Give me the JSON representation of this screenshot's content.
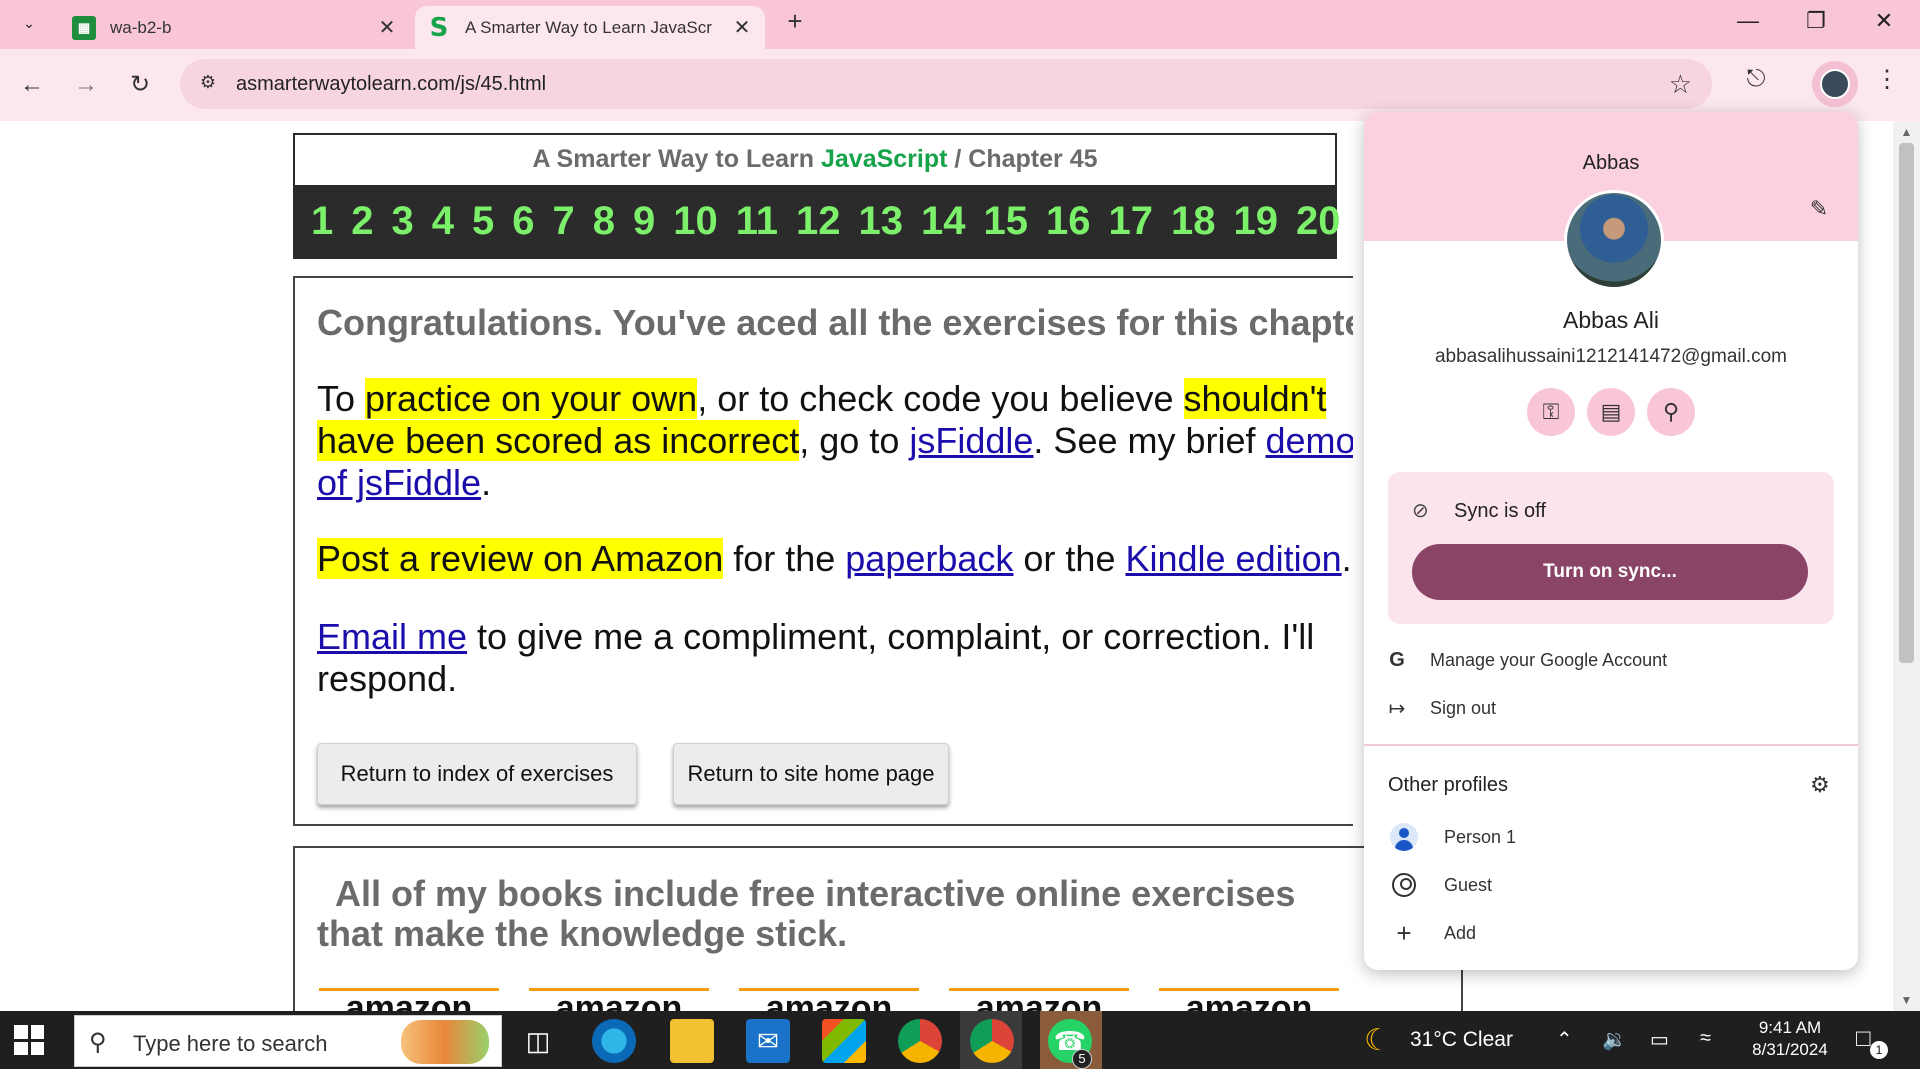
{
  "tabs": [
    {
      "title": "wa-b2-b",
      "favicon": "sheets-icon"
    },
    {
      "title": "A Smarter Way to Learn JavaScr",
      "favicon": "S"
    }
  ],
  "address_bar": {
    "url": "asmarterwaytolearn.com/js/45.html"
  },
  "page": {
    "header": {
      "prefix": "A Smarter Way to Learn ",
      "js": "JavaScript",
      "sep": " / ",
      "chapter": "Chapter 45"
    },
    "chapters": [
      "1",
      "2",
      "3",
      "4",
      "5",
      "6",
      "7",
      "8",
      "9",
      "10",
      "11",
      "12",
      "13",
      "14",
      "15",
      "16",
      "17",
      "18",
      "19",
      "20"
    ],
    "congrats": "Congratulations. You've aced all the exercises for this chapter.",
    "p1": {
      "t1": "To ",
      "h1": "practice on your own",
      "t2": ", or to check code you believe ",
      "h2": "shouldn't have been scored as incorrect",
      "t3": ", go to ",
      "l1": "jsFiddle",
      "t4": ". See my brief ",
      "l2": "demo of jsFiddle",
      "t5": "."
    },
    "p2": {
      "h1": "Post a review on Amazon",
      "t1": " for the ",
      "l1": "paperback",
      "t2": " or the ",
      "l2": "Kindle edition",
      "t3": "."
    },
    "p3": {
      "l1": "Email me",
      "t1": " to give me a compliment, complaint, or correction. I'll respond."
    },
    "buttons": {
      "index": "Return to index of exercises",
      "home": "Return to site home page"
    },
    "books_text": "All of my books include free interactive online exercises that make the knowledge stick.",
    "amazon_logos": [
      "amazon",
      "amazon",
      "amazon",
      "amazon",
      "amazon"
    ]
  },
  "profile_popup": {
    "header_name": "Abbas",
    "full_name": "Abbas Ali",
    "email": "abbasalihussaini1212141472@gmail.com",
    "sync_status": "Sync is off",
    "sync_button": "Turn on sync...",
    "menu": [
      {
        "icon": "google-icon",
        "label": "Manage your Google Account"
      },
      {
        "icon": "sign-out-icon",
        "label": "Sign out"
      }
    ],
    "other_profiles_title": "Other profiles",
    "profiles": [
      {
        "icon": "person-icon",
        "label": "Person 1"
      },
      {
        "icon": "guest-icon",
        "label": "Guest"
      },
      {
        "icon": "add-icon",
        "label": "Add"
      }
    ]
  },
  "taskbar": {
    "search_placeholder": "Type here to search",
    "weather": "31°C  Clear",
    "time": "9:41 AM",
    "date": "8/31/2024",
    "whatsapp_badge": "5",
    "notification_count": "1"
  }
}
